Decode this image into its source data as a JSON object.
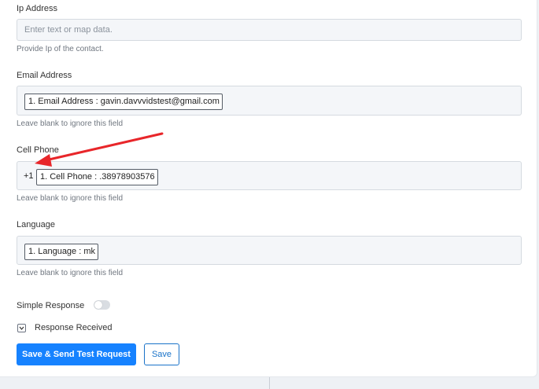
{
  "ip_address": {
    "label": "Ip Address",
    "placeholder": "Enter text or map data.",
    "help": "Provide Ip of the contact."
  },
  "email_address": {
    "label": "Email Address",
    "value": "1. Email Address : gavin.davvvidstest@gmail.com",
    "help": "Leave blank to ignore this field"
  },
  "cell_phone": {
    "label": "Cell Phone",
    "prefix": "+1",
    "value": "1. Cell Phone : .38978903576",
    "help": "Leave blank to ignore this field"
  },
  "language": {
    "label": "Language",
    "value": "1. Language : mk",
    "help": "Leave blank to ignore this field"
  },
  "simple_response": {
    "label": "Simple Response",
    "enabled": false
  },
  "response_received": {
    "label": "Response Received",
    "icon": "chevron-down-icon"
  },
  "buttons": {
    "save_send": "Save & Send Test Request",
    "save": "Save"
  },
  "colors": {
    "primary": "#1682ff",
    "annotation_arrow": "#e8262a"
  }
}
